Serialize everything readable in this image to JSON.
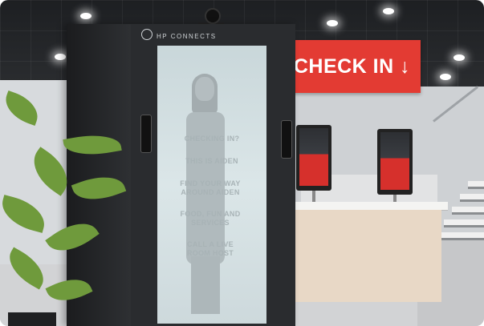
{
  "sign": {
    "text": "CHECK IN ↓",
    "color": "#e33b33"
  },
  "booth": {
    "brand": "HP CONNECTS",
    "hologram_lines": [
      "CHECKING IN?",
      "THIS IS AIDEN",
      "FIND YOUR WAY AROUND AIDEN",
      "FOOD, FUN AND SERVICES",
      "CALL A LIVE ROOM HOST"
    ]
  },
  "kiosks": {
    "count": 2,
    "screen_color": "#d6302c"
  },
  "colors": {
    "wall": "#ced1d4",
    "desk": "#e8d8c6",
    "plant": "#6f9a3c"
  }
}
